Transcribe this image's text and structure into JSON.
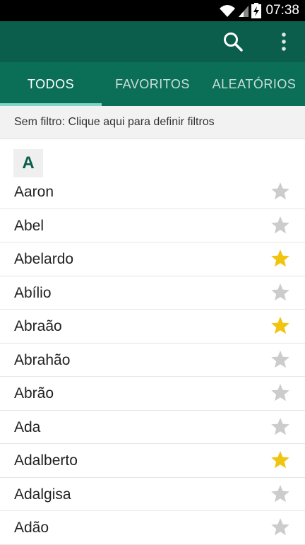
{
  "status_bar": {
    "time": "07:38",
    "icons": [
      "wifi-icon",
      "signal-icon",
      "battery-charging-icon"
    ]
  },
  "toolbar": {
    "icons": [
      "search-icon",
      "more-vert-icon"
    ]
  },
  "tabs": [
    {
      "label": "TODOS",
      "active": true
    },
    {
      "label": "FAVORITOS",
      "active": false
    },
    {
      "label": "ALEATÓRIOS",
      "active": false
    }
  ],
  "filter": {
    "text": "Sem filtro: Clique aqui para definir filtros"
  },
  "section": {
    "letter": "A"
  },
  "colors": {
    "toolbar": "#0b5e4b",
    "tabs": "#0b6e57",
    "tab_indicator": "#7fd6c2",
    "star_on": "#f1c40f",
    "star_off": "#cccccc"
  },
  "names": [
    {
      "name": "Aaron",
      "favorite": false
    },
    {
      "name": "Abel",
      "favorite": false
    },
    {
      "name": "Abelardo",
      "favorite": true
    },
    {
      "name": "Abílio",
      "favorite": false
    },
    {
      "name": "Abraão",
      "favorite": true
    },
    {
      "name": "Abrahão",
      "favorite": false
    },
    {
      "name": "Abrão",
      "favorite": false
    },
    {
      "name": "Ada",
      "favorite": false
    },
    {
      "name": "Adalberto",
      "favorite": true
    },
    {
      "name": "Adalgisa",
      "favorite": false
    },
    {
      "name": "Adão",
      "favorite": false
    }
  ]
}
